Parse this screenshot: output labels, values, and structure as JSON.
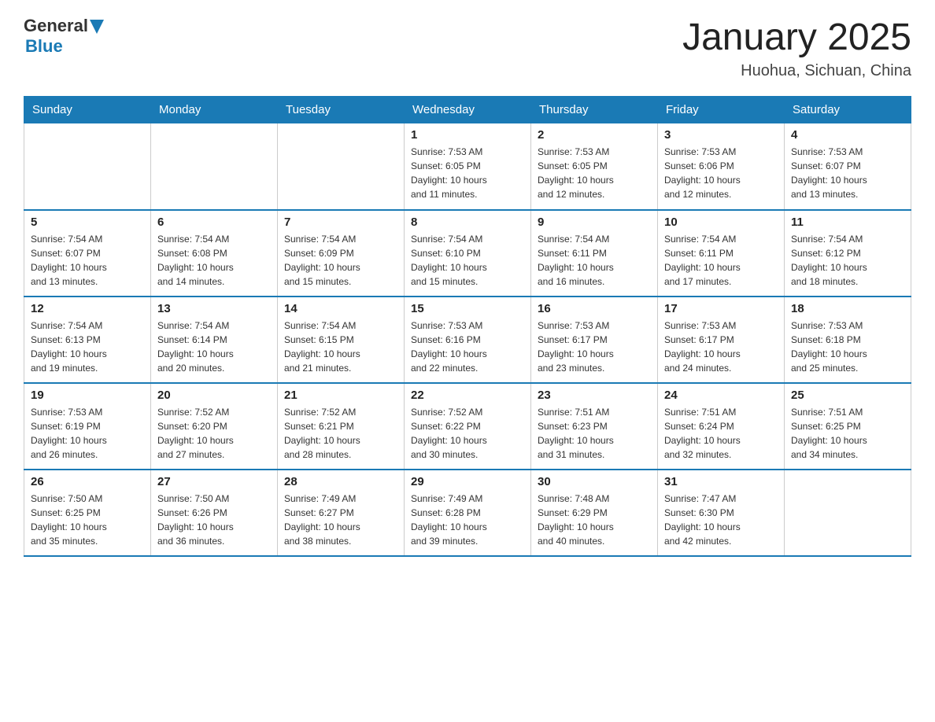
{
  "header": {
    "logo": {
      "general": "General",
      "blue": "Blue"
    },
    "title": "January 2025",
    "subtitle": "Huohua, Sichuan, China"
  },
  "weekdays": [
    "Sunday",
    "Monday",
    "Tuesday",
    "Wednesday",
    "Thursday",
    "Friday",
    "Saturday"
  ],
  "weeks": [
    [
      {
        "day": "",
        "info": ""
      },
      {
        "day": "",
        "info": ""
      },
      {
        "day": "",
        "info": ""
      },
      {
        "day": "1",
        "info": "Sunrise: 7:53 AM\nSunset: 6:05 PM\nDaylight: 10 hours\nand 11 minutes."
      },
      {
        "day": "2",
        "info": "Sunrise: 7:53 AM\nSunset: 6:05 PM\nDaylight: 10 hours\nand 12 minutes."
      },
      {
        "day": "3",
        "info": "Sunrise: 7:53 AM\nSunset: 6:06 PM\nDaylight: 10 hours\nand 12 minutes."
      },
      {
        "day": "4",
        "info": "Sunrise: 7:53 AM\nSunset: 6:07 PM\nDaylight: 10 hours\nand 13 minutes."
      }
    ],
    [
      {
        "day": "5",
        "info": "Sunrise: 7:54 AM\nSunset: 6:07 PM\nDaylight: 10 hours\nand 13 minutes."
      },
      {
        "day": "6",
        "info": "Sunrise: 7:54 AM\nSunset: 6:08 PM\nDaylight: 10 hours\nand 14 minutes."
      },
      {
        "day": "7",
        "info": "Sunrise: 7:54 AM\nSunset: 6:09 PM\nDaylight: 10 hours\nand 15 minutes."
      },
      {
        "day": "8",
        "info": "Sunrise: 7:54 AM\nSunset: 6:10 PM\nDaylight: 10 hours\nand 15 minutes."
      },
      {
        "day": "9",
        "info": "Sunrise: 7:54 AM\nSunset: 6:11 PM\nDaylight: 10 hours\nand 16 minutes."
      },
      {
        "day": "10",
        "info": "Sunrise: 7:54 AM\nSunset: 6:11 PM\nDaylight: 10 hours\nand 17 minutes."
      },
      {
        "day": "11",
        "info": "Sunrise: 7:54 AM\nSunset: 6:12 PM\nDaylight: 10 hours\nand 18 minutes."
      }
    ],
    [
      {
        "day": "12",
        "info": "Sunrise: 7:54 AM\nSunset: 6:13 PM\nDaylight: 10 hours\nand 19 minutes."
      },
      {
        "day": "13",
        "info": "Sunrise: 7:54 AM\nSunset: 6:14 PM\nDaylight: 10 hours\nand 20 minutes."
      },
      {
        "day": "14",
        "info": "Sunrise: 7:54 AM\nSunset: 6:15 PM\nDaylight: 10 hours\nand 21 minutes."
      },
      {
        "day": "15",
        "info": "Sunrise: 7:53 AM\nSunset: 6:16 PM\nDaylight: 10 hours\nand 22 minutes."
      },
      {
        "day": "16",
        "info": "Sunrise: 7:53 AM\nSunset: 6:17 PM\nDaylight: 10 hours\nand 23 minutes."
      },
      {
        "day": "17",
        "info": "Sunrise: 7:53 AM\nSunset: 6:17 PM\nDaylight: 10 hours\nand 24 minutes."
      },
      {
        "day": "18",
        "info": "Sunrise: 7:53 AM\nSunset: 6:18 PM\nDaylight: 10 hours\nand 25 minutes."
      }
    ],
    [
      {
        "day": "19",
        "info": "Sunrise: 7:53 AM\nSunset: 6:19 PM\nDaylight: 10 hours\nand 26 minutes."
      },
      {
        "day": "20",
        "info": "Sunrise: 7:52 AM\nSunset: 6:20 PM\nDaylight: 10 hours\nand 27 minutes."
      },
      {
        "day": "21",
        "info": "Sunrise: 7:52 AM\nSunset: 6:21 PM\nDaylight: 10 hours\nand 28 minutes."
      },
      {
        "day": "22",
        "info": "Sunrise: 7:52 AM\nSunset: 6:22 PM\nDaylight: 10 hours\nand 30 minutes."
      },
      {
        "day": "23",
        "info": "Sunrise: 7:51 AM\nSunset: 6:23 PM\nDaylight: 10 hours\nand 31 minutes."
      },
      {
        "day": "24",
        "info": "Sunrise: 7:51 AM\nSunset: 6:24 PM\nDaylight: 10 hours\nand 32 minutes."
      },
      {
        "day": "25",
        "info": "Sunrise: 7:51 AM\nSunset: 6:25 PM\nDaylight: 10 hours\nand 34 minutes."
      }
    ],
    [
      {
        "day": "26",
        "info": "Sunrise: 7:50 AM\nSunset: 6:25 PM\nDaylight: 10 hours\nand 35 minutes."
      },
      {
        "day": "27",
        "info": "Sunrise: 7:50 AM\nSunset: 6:26 PM\nDaylight: 10 hours\nand 36 minutes."
      },
      {
        "day": "28",
        "info": "Sunrise: 7:49 AM\nSunset: 6:27 PM\nDaylight: 10 hours\nand 38 minutes."
      },
      {
        "day": "29",
        "info": "Sunrise: 7:49 AM\nSunset: 6:28 PM\nDaylight: 10 hours\nand 39 minutes."
      },
      {
        "day": "30",
        "info": "Sunrise: 7:48 AM\nSunset: 6:29 PM\nDaylight: 10 hours\nand 40 minutes."
      },
      {
        "day": "31",
        "info": "Sunrise: 7:47 AM\nSunset: 6:30 PM\nDaylight: 10 hours\nand 42 minutes."
      },
      {
        "day": "",
        "info": ""
      }
    ]
  ]
}
